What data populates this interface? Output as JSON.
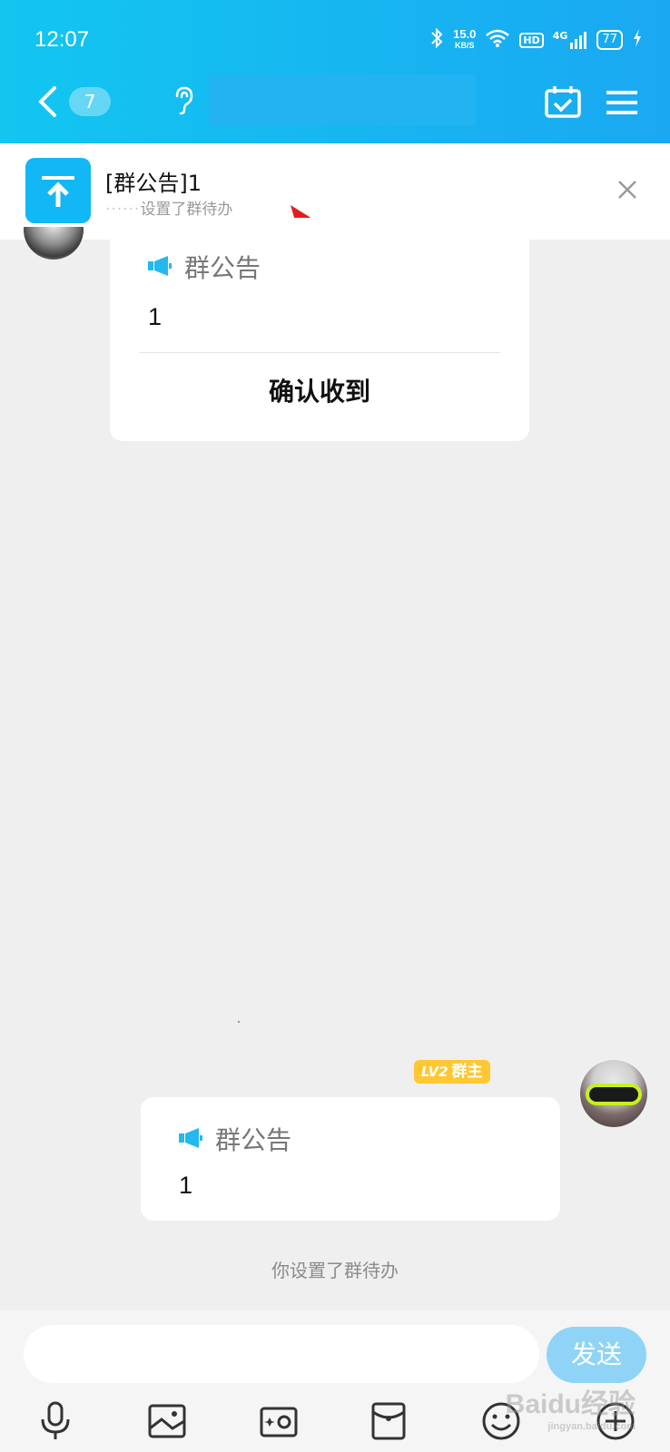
{
  "status_bar": {
    "time": "12:07",
    "net_speed": "15.0",
    "net_unit": "KB/S",
    "hd": "HD",
    "network": "4G",
    "battery": "77"
  },
  "nav": {
    "unread_count": "7"
  },
  "banner": {
    "title": "[群公告]1",
    "subtitle_masked": "······",
    "subtitle": "设置了群待办"
  },
  "messages": {
    "first": {
      "header": "群公告",
      "body": "1",
      "confirm": "确认收到"
    },
    "second": {
      "level": "LV2",
      "role": "群主",
      "header": "群公告",
      "body": "1"
    }
  },
  "system_message": "你设置了群待办",
  "composer": {
    "input_placeholder": "",
    "send_label": "发送"
  },
  "watermark": {
    "text": "Baidu经验",
    "sub": "jingyan.baidu.com"
  },
  "colors": {
    "accent": "#12b7f5",
    "badge": "#ffc832",
    "send_disabled": "#8fd4f7"
  }
}
